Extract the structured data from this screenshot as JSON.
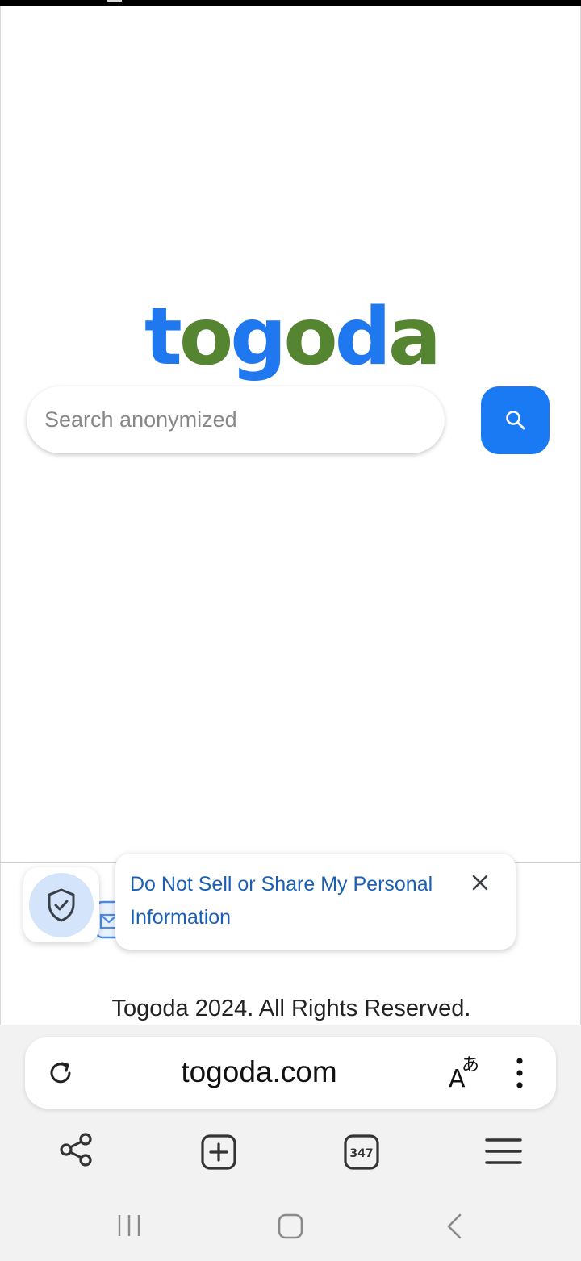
{
  "page": {
    "logo_part1": "togo",
    "logo_part2": "da",
    "search": {
      "placeholder": "Search anonymized"
    },
    "consent": {
      "link_text": "Do Not Sell or Share My Personal Information"
    },
    "footer": {
      "copyright": "Togoda 2024. All Rights Reserved."
    }
  },
  "browser": {
    "url": "togoda.com",
    "tab_count": "347"
  },
  "colors": {
    "logo_blue": "#1f78f0",
    "logo_green": "#568531",
    "search_button": "#1a7af4",
    "consent_link": "#1a5fb4"
  }
}
